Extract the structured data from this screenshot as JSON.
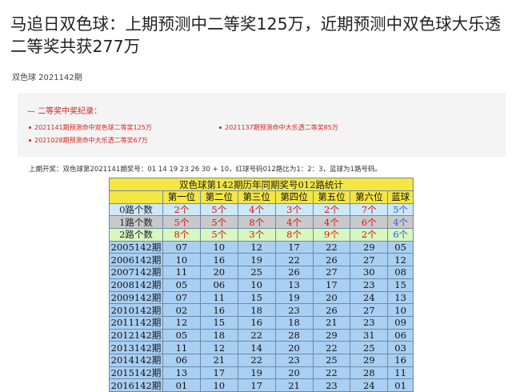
{
  "article": {
    "title": "马追日双色球：上期预测中二等奖125万，近期预测中双色球大乐透二等奖共获277万",
    "meta": "双色球 2021142期"
  },
  "awards": {
    "heading": "二等奖中奖纪录：",
    "items": [
      "2021141期预测命中双色球二等奖125万",
      "2021137期预测命中大乐透二等奖85万",
      "2021028期预测命中大乐透二等奖67万"
    ],
    "accent_color": "#d62020"
  },
  "previous_draw": "上期开奖：双色球第2021141期奖号：01 14 19 23 26 30 + 10，红球号码012路比为1：2：3，蓝球为1路号码。",
  "table": {
    "title": "双色球第142期历年同期奖号012路统计",
    "columns": [
      "第一位",
      "第二位",
      "第三位",
      "第四位",
      "第五位",
      "第六位",
      "蓝球"
    ],
    "route_rows": [
      {
        "label": "0路个数",
        "values": [
          "2个",
          "5个",
          "4个",
          "3个",
          "2个",
          "7个",
          "5个"
        ]
      },
      {
        "label": "1路个数",
        "values": [
          "5个",
          "5个",
          "8个",
          "4个",
          "4个",
          "6个",
          "4个"
        ]
      },
      {
        "label": "2路个数",
        "values": [
          "8个",
          "5个",
          "3个",
          "8个",
          "9个",
          "2个",
          "6个"
        ]
      }
    ],
    "year_rows": [
      {
        "label": "2005142期",
        "values": [
          "07",
          "10",
          "12",
          "17",
          "22",
          "29",
          "05"
        ]
      },
      {
        "label": "2006142期",
        "values": [
          "10",
          "16",
          "19",
          "22",
          "26",
          "27",
          "12"
        ]
      },
      {
        "label": "2007142期",
        "values": [
          "11",
          "20",
          "25",
          "26",
          "27",
          "30",
          "08"
        ]
      },
      {
        "label": "2008142期",
        "values": [
          "05",
          "06",
          "10",
          "13",
          "17",
          "23",
          "15"
        ]
      },
      {
        "label": "2009142期",
        "values": [
          "07",
          "11",
          "15",
          "19",
          "20",
          "24",
          "13"
        ]
      },
      {
        "label": "2010142期",
        "values": [
          "02",
          "16",
          "18",
          "23",
          "26",
          "27",
          "10"
        ]
      },
      {
        "label": "2011142期",
        "values": [
          "12",
          "15",
          "16",
          "18",
          "21",
          "23",
          "09"
        ]
      },
      {
        "label": "2012142期",
        "values": [
          "05",
          "18",
          "22",
          "28",
          "29",
          "31",
          "06"
        ]
      },
      {
        "label": "2013142期",
        "values": [
          "11",
          "12",
          "14",
          "20",
          "22",
          "25",
          "03"
        ]
      },
      {
        "label": "2014142期",
        "values": [
          "06",
          "21",
          "22",
          "23",
          "25",
          "29",
          "16"
        ]
      },
      {
        "label": "2015142期",
        "values": [
          "13",
          "17",
          "19",
          "20",
          "22",
          "28",
          "11"
        ]
      },
      {
        "label": "2016142期",
        "values": [
          "01",
          "10",
          "17",
          "21",
          "23",
          "24",
          "01"
        ]
      }
    ],
    "colors": {
      "header": "#f5e642",
      "route0": "#cde8f7",
      "route1": "#c9c9c9",
      "route2": "#d8f7bf",
      "year": "#a9cff2",
      "red": "#e01010",
      "blue": "#2b5fe0"
    }
  }
}
